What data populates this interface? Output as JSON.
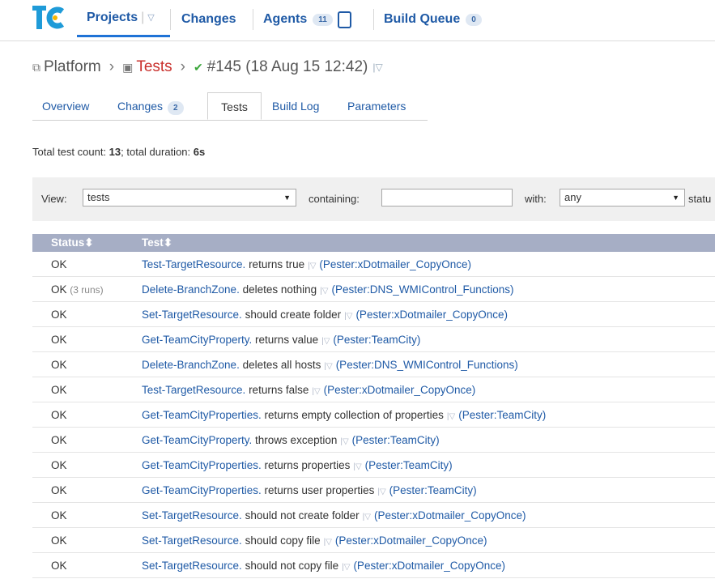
{
  "nav": {
    "projects": "Projects",
    "changes": "Changes",
    "agents": "Agents",
    "agents_count": "11",
    "build_queue": "Build Queue",
    "build_queue_count": "0"
  },
  "breadcrumb": {
    "project": "Platform",
    "config": "Tests",
    "build": "#145 (18 Aug 15 12:42)"
  },
  "tabs": {
    "overview": "Overview",
    "changes": "Changes",
    "changes_count": "2",
    "tests": "Tests",
    "build_log": "Build Log",
    "parameters": "Parameters"
  },
  "summary": {
    "count_label": "Total test count: ",
    "count": "13",
    "duration_label": "; total duration: ",
    "duration": "6s"
  },
  "filter": {
    "view_label": "View:",
    "view_value": "tests",
    "containing_label": "containing:",
    "containing_value": "",
    "with_label": "with:",
    "with_value": "any",
    "status_label": "statu"
  },
  "table": {
    "header_status": "Status",
    "header_test": "Test",
    "rows": [
      {
        "status": "OK",
        "runs": "",
        "name": "Test-TargetResource.",
        "desc": " returns true",
        "pkg": "(Pester:xDotmailer_CopyOnce)"
      },
      {
        "status": "OK",
        "runs": "(3 runs)",
        "name": "Delete-BranchZone.",
        "desc": " deletes nothing",
        "pkg": "(Pester:DNS_WMIControl_Functions)"
      },
      {
        "status": "OK",
        "runs": "",
        "name": "Set-TargetResource.",
        "desc": " should create folder",
        "pkg": "(Pester:xDotmailer_CopyOnce)"
      },
      {
        "status": "OK",
        "runs": "",
        "name": "Get-TeamCityProperty.",
        "desc": " returns value",
        "pkg": "(Pester:TeamCity)"
      },
      {
        "status": "OK",
        "runs": "",
        "name": "Delete-BranchZone.",
        "desc": " deletes all hosts",
        "pkg": "(Pester:DNS_WMIControl_Functions)"
      },
      {
        "status": "OK",
        "runs": "",
        "name": "Test-TargetResource.",
        "desc": " returns false",
        "pkg": "(Pester:xDotmailer_CopyOnce)"
      },
      {
        "status": "OK",
        "runs": "",
        "name": "Get-TeamCityProperties.",
        "desc": " returns empty collection of properties",
        "pkg": "(Pester:TeamCity)"
      },
      {
        "status": "OK",
        "runs": "",
        "name": "Get-TeamCityProperty.",
        "desc": " throws exception",
        "pkg": "(Pester:TeamCity)"
      },
      {
        "status": "OK",
        "runs": "",
        "name": "Get-TeamCityProperties.",
        "desc": " returns properties",
        "pkg": "(Pester:TeamCity)"
      },
      {
        "status": "OK",
        "runs": "",
        "name": "Get-TeamCityProperties.",
        "desc": " returns user properties",
        "pkg": "(Pester:TeamCity)"
      },
      {
        "status": "OK",
        "runs": "",
        "name": "Set-TargetResource.",
        "desc": " should not create folder",
        "pkg": "(Pester:xDotmailer_CopyOnce)"
      },
      {
        "status": "OK",
        "runs": "",
        "name": "Set-TargetResource.",
        "desc": " should copy file",
        "pkg": "(Pester:xDotmailer_CopyOnce)"
      },
      {
        "status": "OK",
        "runs": "",
        "name": "Set-TargetResource.",
        "desc": " should not copy file",
        "pkg": "(Pester:xDotmailer_CopyOnce)"
      }
    ]
  }
}
